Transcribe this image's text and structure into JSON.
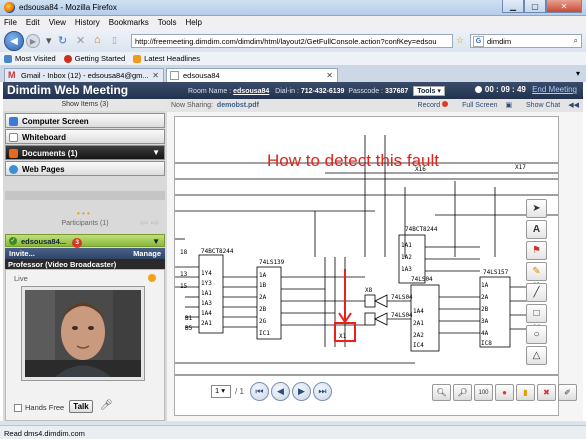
{
  "window": {
    "title": "edsousa84 - Mozilla Firefox"
  },
  "menu": [
    "File",
    "Edit",
    "View",
    "History",
    "Bookmarks",
    "Tools",
    "Help"
  ],
  "nav": {
    "url": "http://freemeeting.dimdim.com/dimdim/html/layout2/GetFullConsole.action?confKey=edsou",
    "search_value": "dimdim"
  },
  "bookmarks": [
    "Most Visited",
    "Getting Started",
    "Latest Headlines"
  ],
  "tabs": [
    {
      "label": "Gmail - Inbox (12) - edsousa84@gm...",
      "active": false
    },
    {
      "label": "edsousa84",
      "active": true
    }
  ],
  "app": {
    "title": "Dimdim Web Meeting",
    "room_label": "Room Name :",
    "room_value": "edsousa84",
    "dialin_label": "Dial-in :",
    "dialin_value": "712-432-6139",
    "passcode_label": "Passcode :",
    "passcode_value": "337687",
    "tools_label": "Tools",
    "timer": "00 : 09 : 49",
    "end_meeting": "End Meeting"
  },
  "left": {
    "show_items": "Show Items (3)",
    "pods": [
      "Computer Screen",
      "Whiteboard",
      "Documents (1)",
      "Web Pages"
    ],
    "participants": "Participants (1)",
    "participant_name": "edsousa84...",
    "participant_badge": "3",
    "invite": "Invite...",
    "manage": "Manage",
    "professor": "Professor (Video Broadcaster)",
    "live": "Live",
    "hands_free": "Hands Free",
    "talk": "Talk"
  },
  "share": {
    "now_sharing_label": "Now Sharing:",
    "now_sharing_value": "demobst.pdf",
    "record": "Record",
    "full_screen": "Full Screen",
    "show_chat": "Show Chat",
    "annotation": "How to detect this fault",
    "page_value": "1",
    "page_of": "/ 1"
  },
  "status": "Read dms4.dimdim.com",
  "colors": {
    "header_bg": "#22324e",
    "annotation": "#e8221a",
    "participant_bar": "#8ab83a"
  }
}
